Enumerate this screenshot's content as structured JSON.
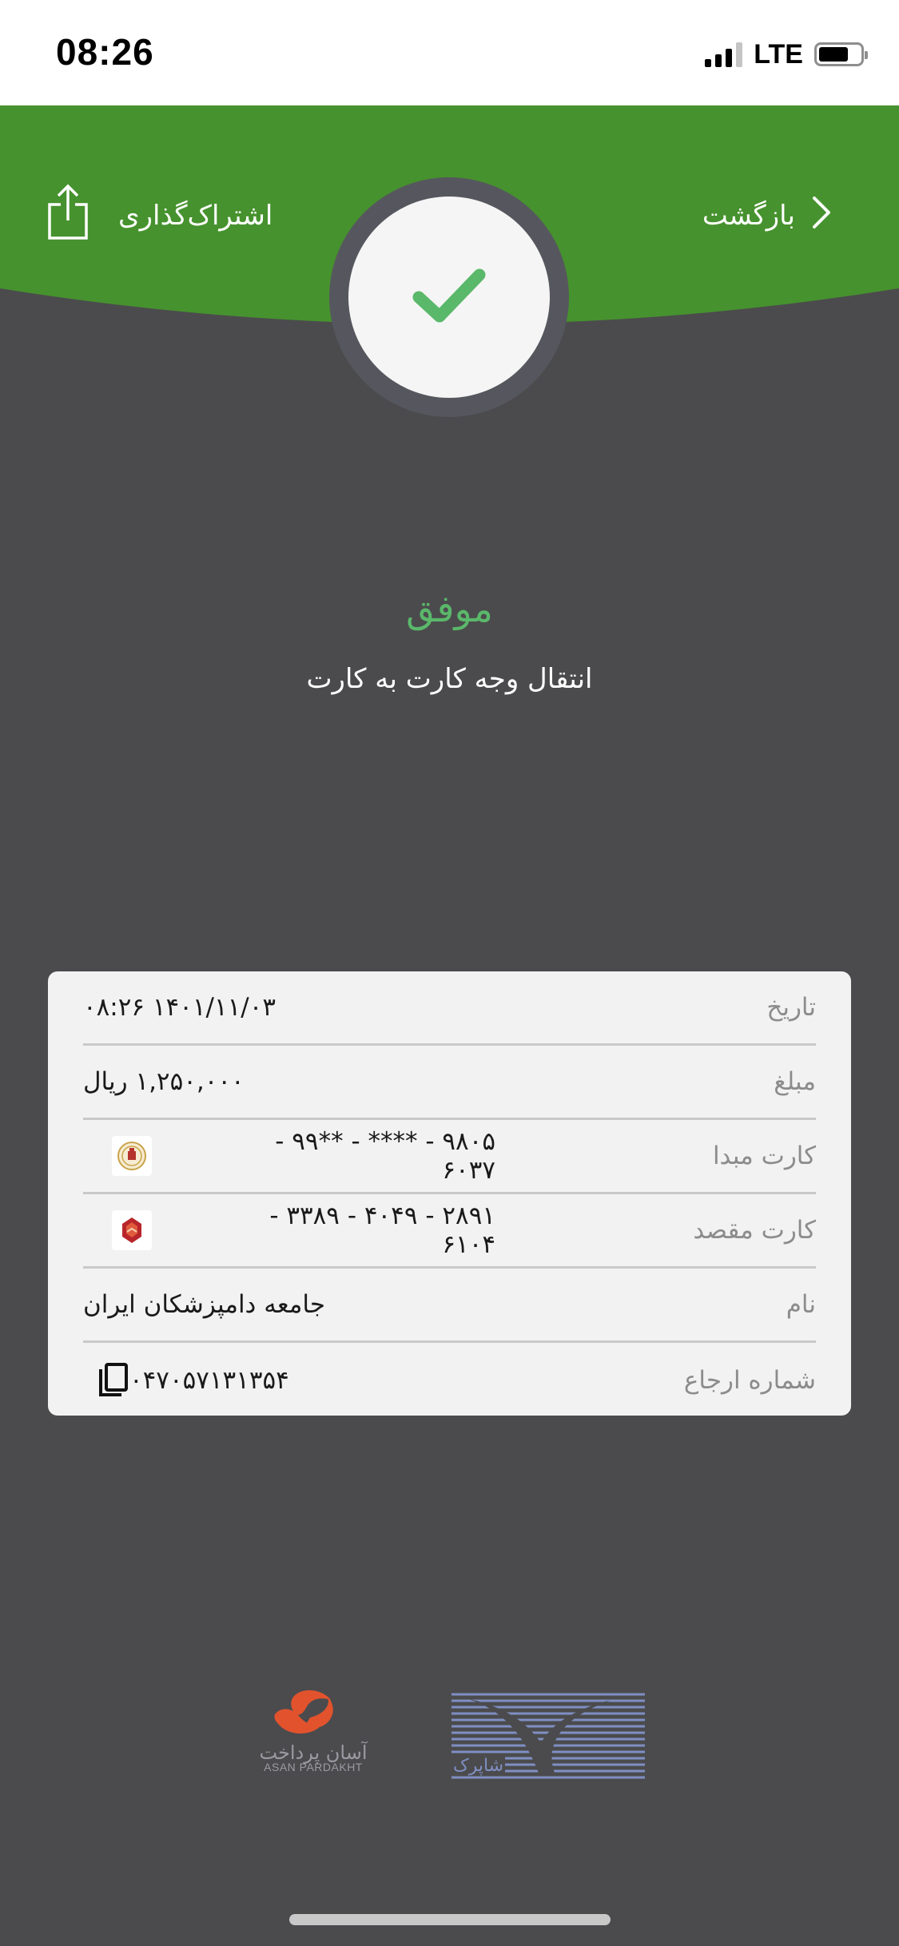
{
  "status_bar": {
    "time": "08:26",
    "network": "LTE",
    "icons": [
      "signal-icon",
      "battery-icon"
    ]
  },
  "header": {
    "back_label": "بازگشت",
    "share_label": "اشتراک‌گذاری",
    "icons": [
      "chevron-right-icon",
      "share-icon",
      "checkmark-icon"
    ],
    "colors": {
      "header_green": "#46922e",
      "check_green": "#5ab86a",
      "background": "#4b4b4d"
    }
  },
  "transaction": {
    "status": "موفق",
    "type": "انتقال وجه کارت به کارت"
  },
  "receipt": {
    "rows": [
      {
        "label": "تاریخ",
        "value": "۱۴۰۱/۱۱/۰۳ ۰۸:۲۶"
      },
      {
        "label": "مبلغ",
        "value": "۱,۲۵۰,۰۰۰ ریال"
      },
      {
        "label": "کارت مبدا",
        "value": "۹۸۰۵ - **** - **۹۹ - ۶۰۳۷",
        "icon": "bank-melli-logo-icon"
      },
      {
        "label": "کارت مقصد",
        "value": "۲۸۹۱ - ۴۰۴۹ - ۳۳۸۹ - ۶۱۰۴",
        "icon": "bank-maskan-logo-icon"
      },
      {
        "label": "نام",
        "value": "جامعه دامپزشکان ایران"
      },
      {
        "label": "شماره ارجاع",
        "value": "۰۴۷۰۵۷۱۳۱۳۵۴",
        "icon": "copy-icon"
      }
    ]
  },
  "footer": {
    "asan_label_fa": "آسان پرداخت",
    "asan_label_en": "ASAN PARDAKHT",
    "shaparak_label": "شاپرک",
    "icons": [
      "asan-pardakht-logo-icon",
      "shaparak-logo-icon"
    ]
  }
}
